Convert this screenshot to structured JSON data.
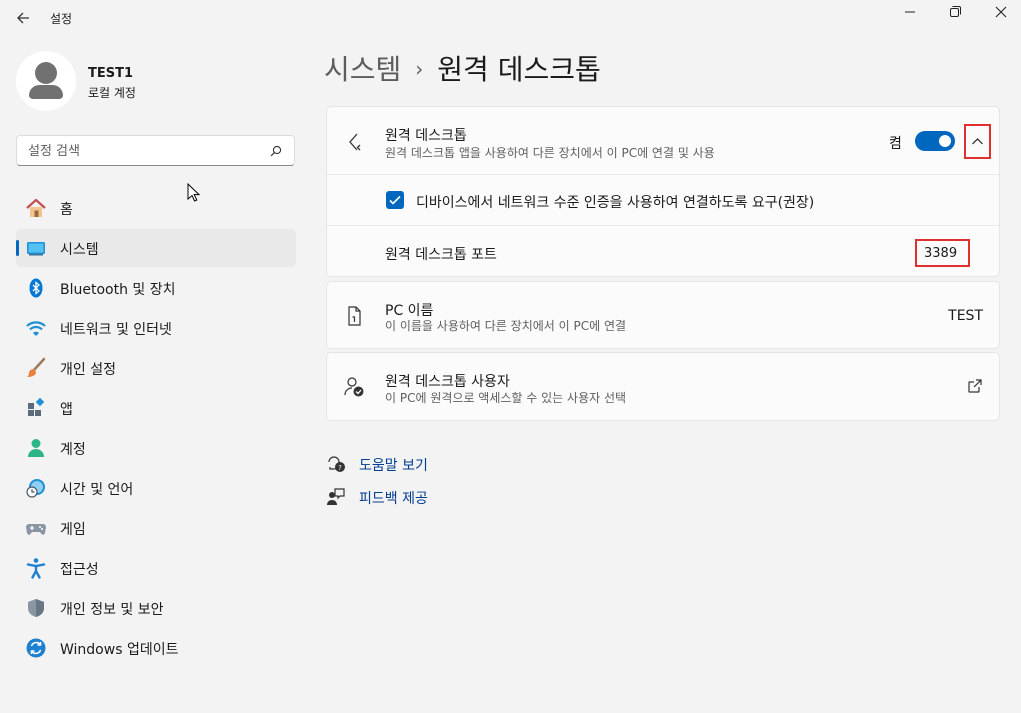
{
  "app": {
    "title": "설정"
  },
  "profile": {
    "name": "TEST1",
    "account_type": "로컬 계정"
  },
  "search": {
    "placeholder": "설정 검색"
  },
  "sidebar": {
    "items": [
      {
        "label": "홈",
        "icon": "home-icon"
      },
      {
        "label": "시스템",
        "icon": "system-icon",
        "selected": true
      },
      {
        "label": "Bluetooth 및 장치",
        "icon": "bluetooth-icon"
      },
      {
        "label": "네트워크 및 인터넷",
        "icon": "wifi-icon"
      },
      {
        "label": "개인 설정",
        "icon": "brush-icon"
      },
      {
        "label": "앱",
        "icon": "apps-icon"
      },
      {
        "label": "계정",
        "icon": "accounts-icon"
      },
      {
        "label": "시간 및 언어",
        "icon": "time-language-icon"
      },
      {
        "label": "게임",
        "icon": "gamepad-icon"
      },
      {
        "label": "접근성",
        "icon": "accessibility-icon"
      },
      {
        "label": "개인 정보 및 보안",
        "icon": "shield-icon"
      },
      {
        "label": "Windows 업데이트",
        "icon": "update-icon"
      }
    ]
  },
  "breadcrumb": {
    "parent": "시스템",
    "separator": "›",
    "current": "원격 데스크톱"
  },
  "remote_desktop": {
    "title": "원격 데스크톱",
    "subtitle": "원격 데스크톱 앱을 사용하여 다른 장치에서 이 PC에 연결 및 사용",
    "toggle_state": "켬",
    "toggle_on": true,
    "nla_label": "디바이스에서 네트워크 수준 인증을 사용하여 연결하도록 요구(권장)",
    "nla_checked": true,
    "port_label": "원격 데스크톱 포트",
    "port_value": "3389"
  },
  "pc_name": {
    "title": "PC 이름",
    "subtitle": "이 이름을 사용하여 다른 장치에서 이 PC에 연결",
    "value": "TEST"
  },
  "remote_users": {
    "title": "원격 데스크톱 사용자",
    "subtitle": "이 PC에 원격으로 액세스할 수 있는 사용자 선택"
  },
  "links": {
    "help": "도움말 보기",
    "feedback": "피드백 제공"
  },
  "colors": {
    "accent": "#0067c0",
    "highlight": "#e03030"
  }
}
